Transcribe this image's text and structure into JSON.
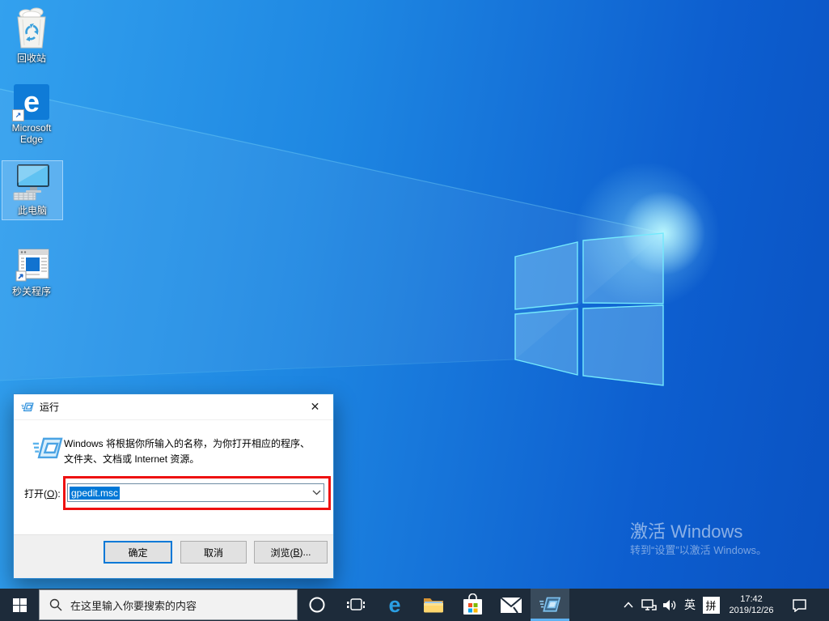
{
  "desktop": {
    "icons": [
      {
        "label": "回收站"
      },
      {
        "label": "Microsoft Edge"
      },
      {
        "label": "此电脑",
        "selected": true
      },
      {
        "label": "秒关程序"
      }
    ],
    "edge_glyph": "e"
  },
  "watermark": {
    "line1": "激活 Windows",
    "line2": "转到“设置”以激活 Windows。"
  },
  "run_dialog": {
    "title": "运行",
    "close_glyph": "✕",
    "message": "Windows 将根据你所输入的名称，为你打开相应的程序、文件夹、文档或 Internet 资源。",
    "open_label": {
      "pre": "打开(",
      "key": "O",
      "post": "):"
    },
    "input_value": "gpedit.msc",
    "buttons": {
      "ok": "确定",
      "cancel": "取消",
      "browse_pre": "浏览(",
      "browse_key": "B",
      "browse_post": ")..."
    }
  },
  "taskbar": {
    "search_placeholder": "在这里输入你要搜索的内容",
    "edge_glyph": "e",
    "tray": {
      "ime_lang": "英",
      "ime_mode": "拼",
      "time": "17:42",
      "date": "2019/12/26"
    }
  },
  "colors": {
    "accent": "#0078d7",
    "taskbar": "#1d2b3a",
    "annotation_red": "#ee1111",
    "selection_blue": "#0078d7",
    "active_underline": "#5fb2f2"
  }
}
